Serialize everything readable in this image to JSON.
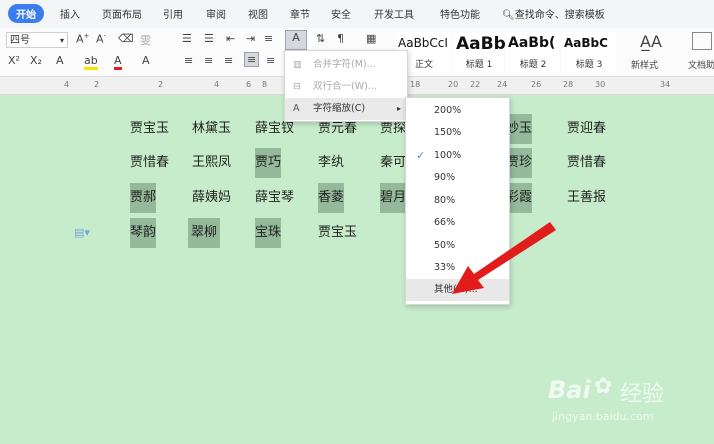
{
  "tabs": [
    "开始",
    "插入",
    "页面布局",
    "引用",
    "审阅",
    "视图",
    "章节",
    "安全",
    "开发工具",
    "特色功能"
  ],
  "search_label": "查找命令、搜索模板",
  "font_size": "四号",
  "styles": [
    {
      "sample": "AaBbCcI",
      "label": "正文"
    },
    {
      "sample": "AaBb",
      "label": "标题 1"
    },
    {
      "sample": "AaBb(",
      "label": "标题 2"
    },
    {
      "sample": "AaBbC",
      "label": "标题 3"
    }
  ],
  "new_style_label": "新样式",
  "doc_assistant_label": "文档助",
  "ruler_numbers": [
    "4",
    "2",
    "2",
    "4",
    "6",
    "8",
    "18",
    "20",
    "22",
    "24",
    "26",
    "28",
    "30",
    "34"
  ],
  "table_rows": [
    [
      "贾宝玉",
      "林黛玉",
      "薛宝钗",
      "贾元春",
      "贾探",
      "妙玉",
      "贾迎春"
    ],
    [
      "贾惜春",
      "王熙凤",
      "贾巧",
      "李纨",
      "秦可",
      "贾珍",
      "贾惜春"
    ],
    [
      "贾郝",
      "薛姨妈",
      "薛宝琴",
      "香菱",
      "碧月",
      "彩霞",
      "王善报"
    ],
    [
      "琴韵",
      "翠柳",
      "宝珠",
      "贾宝玉",
      "",
      "",
      ""
    ]
  ],
  "context_menu": [
    {
      "label": "合并字符(M)...",
      "disabled": true
    },
    {
      "label": "双行合一(W)...",
      "disabled": true
    },
    {
      "label": "字符缩放(C)",
      "disabled": false
    }
  ],
  "scale_options": [
    "200%",
    "150%",
    "100%",
    "90%",
    "80%",
    "66%",
    "50%",
    "33%",
    "其他(M)..."
  ],
  "scale_selected": "100%",
  "watermark": {
    "brand": "Bai",
    "brand2": "经验",
    "url": "jingyan.baidu.com"
  }
}
